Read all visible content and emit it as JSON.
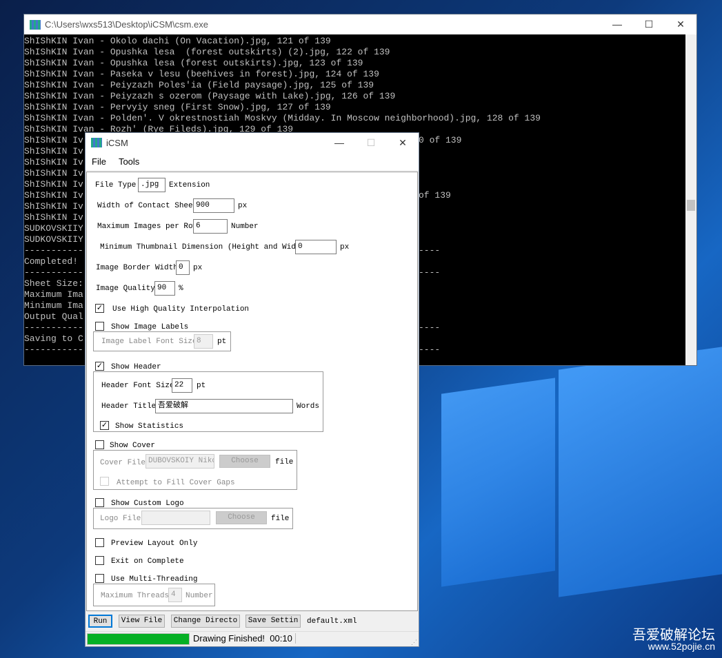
{
  "console": {
    "title": "C:\\Users\\wxs513\\Desktop\\iCSM\\csm.exe",
    "lines": [
      {
        "text": "ShIShKIN Ivan - Okolo dachi (On Vacation).jpg, 121 of 139"
      },
      {
        "text": "ShIShKIN Ivan - Opushka lesa  (forest outskirts) (2).jpg, 122 of 139"
      },
      {
        "text": "ShIShKIN Ivan - Opushka lesa (forest outskirts).jpg, 123 of 139"
      },
      {
        "text": "ShIShKIN Ivan - Paseka v lesu (beehives in forest).jpg, 124 of 139"
      },
      {
        "text": "ShIShKIN Ivan - Peiyzazh Poles'ia (Field paysage).jpg, 125 of 139"
      },
      {
        "text": "ShIShKIN Ivan - Peiyzazh s ozerom (Paysage with Lake).jpg, 126 of 139"
      },
      {
        "text": "ShIShKIN Ivan - Pervyiy sneg (First Snow).jpg, 127 of 139"
      },
      {
        "text": "ShIShKIN Ivan - Polden'. V okrestnostiah Moskvy (Midday. In Moscow neighborhood).jpg, 128 of 139"
      },
      {
        "text": "ShIShKIN Ivan - Rozh' (Rye Fileds).jpg, 129 of 139"
      },
      {
        "text": "ShIShKIN Iv",
        "tail": "0 of 139"
      },
      {
        "text": "ShIShKIN Iv"
      },
      {
        "text": "ShIShKIN Iv"
      },
      {
        "text": "ShIShKIN Iv"
      },
      {
        "text": "ShIShKIN Iv"
      },
      {
        "text": "ShIShKIN Iv",
        "tail": "of 139"
      },
      {
        "text": "ShIShKIN Iv"
      },
      {
        "text": "ShIShKIN Iv"
      },
      {
        "text": "SUDKOVSKIIY"
      },
      {
        "text": "SUDKOVSKIIY"
      },
      {
        "text": "-----------",
        "tail": "----"
      },
      {
        "text": "Completed!"
      },
      {
        "text": "-----------",
        "tail": "----"
      },
      {
        "text": "Sheet Size:"
      },
      {
        "text": "Maximum Ima"
      },
      {
        "text": "Minimum Ima"
      },
      {
        "text": "Output Qual"
      },
      {
        "text": "-----------",
        "tail": "----"
      },
      {
        "text": "Saving to C"
      },
      {
        "text": "-----------",
        "tail": "----"
      }
    ]
  },
  "dialog": {
    "title": "iCSM",
    "menu": [
      "File",
      "Tools"
    ],
    "file_type_label": "File Type",
    "file_type_value": ".jpg",
    "file_type_suffix": "Extension",
    "width_label": "Width of Contact Sheet",
    "width_value": "900",
    "width_unit": "px",
    "max_images_label": "Maximum Images per Row",
    "max_images_value": "6",
    "max_images_unit": "Number",
    "min_thumb_label": "Minimum Thumbnail Dimension (Height and Width)",
    "min_thumb_value": "0",
    "min_thumb_unit": "px",
    "border_label": "Image Border Width",
    "border_value": "0",
    "border_unit": "px",
    "quality_label": "Image Quality",
    "quality_value": "90",
    "quality_unit": "%",
    "hq_label": "Use High Quality Interpolation",
    "hq_checked": true,
    "labels_label": "Show Image Labels",
    "labels_checked": false,
    "label_font_label": "Image Label Font Size",
    "label_font_value": "8",
    "label_font_unit": "pt",
    "header_label": "Show Header",
    "header_checked": true,
    "header_font_label": "Header Font Size",
    "header_font_value": "22",
    "header_font_unit": "pt",
    "header_title_label": "Header Title",
    "header_title_value": "吾爱破解",
    "header_title_unit": "Words",
    "stats_label": "Show Statistics",
    "stats_checked": true,
    "cover_label": "Show Cover",
    "cover_checked": false,
    "cover_file_label": "Cover File",
    "cover_file_value": "DUBOVSKOIY Nikol",
    "choose": "Choose",
    "file_unit": "file",
    "fill_gaps_label": "Attempt to Fill Cover Gaps",
    "logo_label": "Show Custom Logo",
    "logo_checked": false,
    "logo_file_label": "Logo File",
    "logo_file_value": "",
    "preview_label": "Preview Layout Only",
    "exit_label": "Exit on Complete",
    "mt_label": "Use Multi-Threading",
    "threads_label": "Maximum Threads",
    "threads_value": "4",
    "threads_unit": "Number",
    "buttons": {
      "run": "Run",
      "view": "View File",
      "change": "Change Directo",
      "save": "Save Settin"
    },
    "settings_file": "default.xml",
    "status": "Drawing Finished!  00:10",
    "progress": 1.0,
    "progress_color": "#06b025"
  },
  "watermark": {
    "title": "吾爱破解论坛",
    "url": "www.52pojie.cn"
  }
}
